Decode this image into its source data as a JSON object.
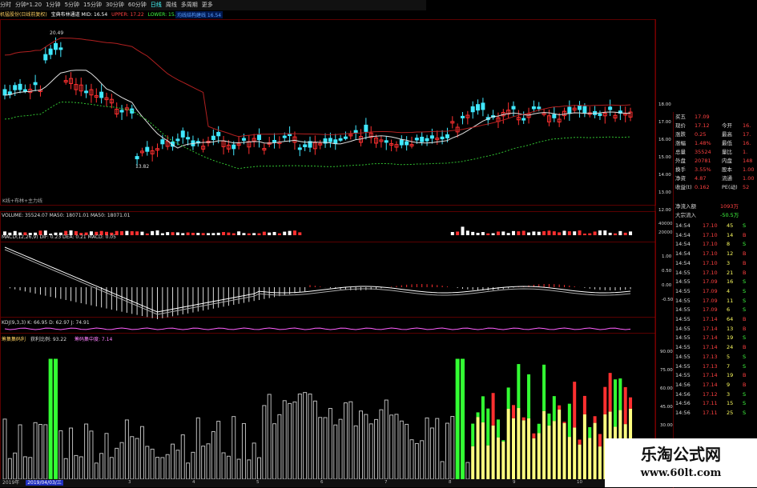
{
  "toolbar": {
    "items": [
      "分时",
      "分钟*1.20",
      "1分钟",
      "5分钟",
      "15分钟",
      "30分钟",
      "60分钟",
      "日线",
      "周线",
      "多周期",
      "更多"
    ],
    "active_index": 7
  },
  "info_bar": {
    "title": "机猛股份(日线前复权)",
    "indicator": "宝典布林通道 MID: 16.54",
    "upper": "UPPER: 17.22",
    "lower": "LOWER: 15.87",
    "line3": "均线结构建线 16.54"
  },
  "price_chart": {
    "high_label": "20.49",
    "low_label": "13.82",
    "note": "K线+布林+主力线",
    "y_ticks": [
      "18.00",
      "17.00",
      "16.00",
      "15.00",
      "14.00",
      "13.00",
      "12.00"
    ]
  },
  "volume_panel": {
    "header": "VOLUME: 35524.07  MA50: 18071.01  MA50: 18071.01",
    "y_ticks": [
      "40000",
      "20000"
    ]
  },
  "macd_panel": {
    "header": "MACD(12,26,9)  DIF: 0.23  DEA: 0.21  MACD: 0.05",
    "y_ticks": [
      "1.00",
      "0.50",
      "0.00",
      "-0.50"
    ]
  },
  "kdj_panel": {
    "header": "KDJ(9,3,3)  K: 66.95  D: 62.97  J: 74.91"
  },
  "chip_panel": {
    "header_a": "筹集集码利",
    "header_b": "获利比例: 93.22",
    "header_c": "筹码集中度: 7.14",
    "y_ticks": [
      "90.00",
      "75.00",
      "60.00",
      "45.00",
      "30.00"
    ]
  },
  "date_bar": {
    "left": "2019年",
    "selected": "2019/04/03/三",
    "marks": [
      "3",
      "4",
      "5",
      "6",
      "7",
      "8",
      "9",
      "10"
    ]
  },
  "right_panel": {
    "quote_rows": [
      {
        "l1": "买五",
        "v1": "17.09",
        "l2": "",
        "v2": ""
      },
      {
        "l1": "现价",
        "v1": "17.12",
        "l2": "今开",
        "v2": "16."
      },
      {
        "l1": "涨跌",
        "v1": "0.25",
        "l2": "最高",
        "v2": "17."
      },
      {
        "l1": "涨幅",
        "v1": "1.48%",
        "l2": "最低",
        "v2": "16."
      },
      {
        "l1": "总量",
        "v1": "35524",
        "l2": "量比",
        "v2": "1."
      },
      {
        "l1": "外盘",
        "v1": "20781",
        "l2": "内盘",
        "v2": "148"
      },
      {
        "l1": "换手",
        "v1": "3.55%",
        "l2": "股本",
        "v2": "1.00"
      },
      {
        "l1": "净资",
        "v1": "4.87",
        "l2": "流通",
        "v2": "1.00"
      },
      {
        "l1": "收益(t)",
        "v1": "0.162",
        "l2": "PE(动)",
        "v2": "52"
      }
    ],
    "flow_rows": [
      {
        "label": "净流入额",
        "value": "1093万"
      },
      {
        "label": "大宗流入",
        "value": "-50.5万"
      }
    ],
    "ticks": [
      {
        "time": "14:54",
        "price": "17.10",
        "vol": "45",
        "side": "S"
      },
      {
        "time": "14:54",
        "price": "17.10",
        "vol": "14",
        "side": "B"
      },
      {
        "time": "14:54",
        "price": "17.10",
        "vol": "8",
        "side": "S"
      },
      {
        "time": "14:54",
        "price": "17.10",
        "vol": "12",
        "side": "B"
      },
      {
        "time": "14:54",
        "price": "17.10",
        "vol": "3",
        "side": "B"
      },
      {
        "time": "14:55",
        "price": "17.10",
        "vol": "21",
        "side": "B"
      },
      {
        "time": "14:55",
        "price": "17.09",
        "vol": "16",
        "side": "S"
      },
      {
        "time": "14:55",
        "price": "17.09",
        "vol": "4",
        "side": "S"
      },
      {
        "time": "14:55",
        "price": "17.09",
        "vol": "11",
        "side": "S"
      },
      {
        "time": "14:55",
        "price": "17.09",
        "vol": "6",
        "side": "S"
      },
      {
        "time": "14:55",
        "price": "17.14",
        "vol": "64",
        "side": "B"
      },
      {
        "time": "14:55",
        "price": "17.14",
        "vol": "13",
        "side": "B"
      },
      {
        "time": "14:55",
        "price": "17.14",
        "vol": "19",
        "side": "S"
      },
      {
        "time": "14:55",
        "price": "17.14",
        "vol": "24",
        "side": "B"
      },
      {
        "time": "14:55",
        "price": "17.13",
        "vol": "5",
        "side": "S"
      },
      {
        "time": "14:55",
        "price": "17.13",
        "vol": "7",
        "side": "S"
      },
      {
        "time": "14:55",
        "price": "17.14",
        "vol": "19",
        "side": "B"
      },
      {
        "time": "14:56",
        "price": "17.14",
        "vol": "9",
        "side": "B"
      },
      {
        "time": "14:56",
        "price": "17.12",
        "vol": "3",
        "side": "S"
      },
      {
        "time": "14:56",
        "price": "17.11",
        "vol": "15",
        "side": "S"
      },
      {
        "time": "14:56",
        "price": "17.11",
        "vol": "25",
        "side": "S"
      }
    ]
  },
  "watermark": {
    "line1": "乐淘公式网",
    "line2": "www.60lt.com"
  },
  "colors": {
    "up": "#ff3030",
    "down": "#40e8ff",
    "green": "#33ff33",
    "yellow": "#ffff80",
    "grid": "#5a0000"
  }
}
